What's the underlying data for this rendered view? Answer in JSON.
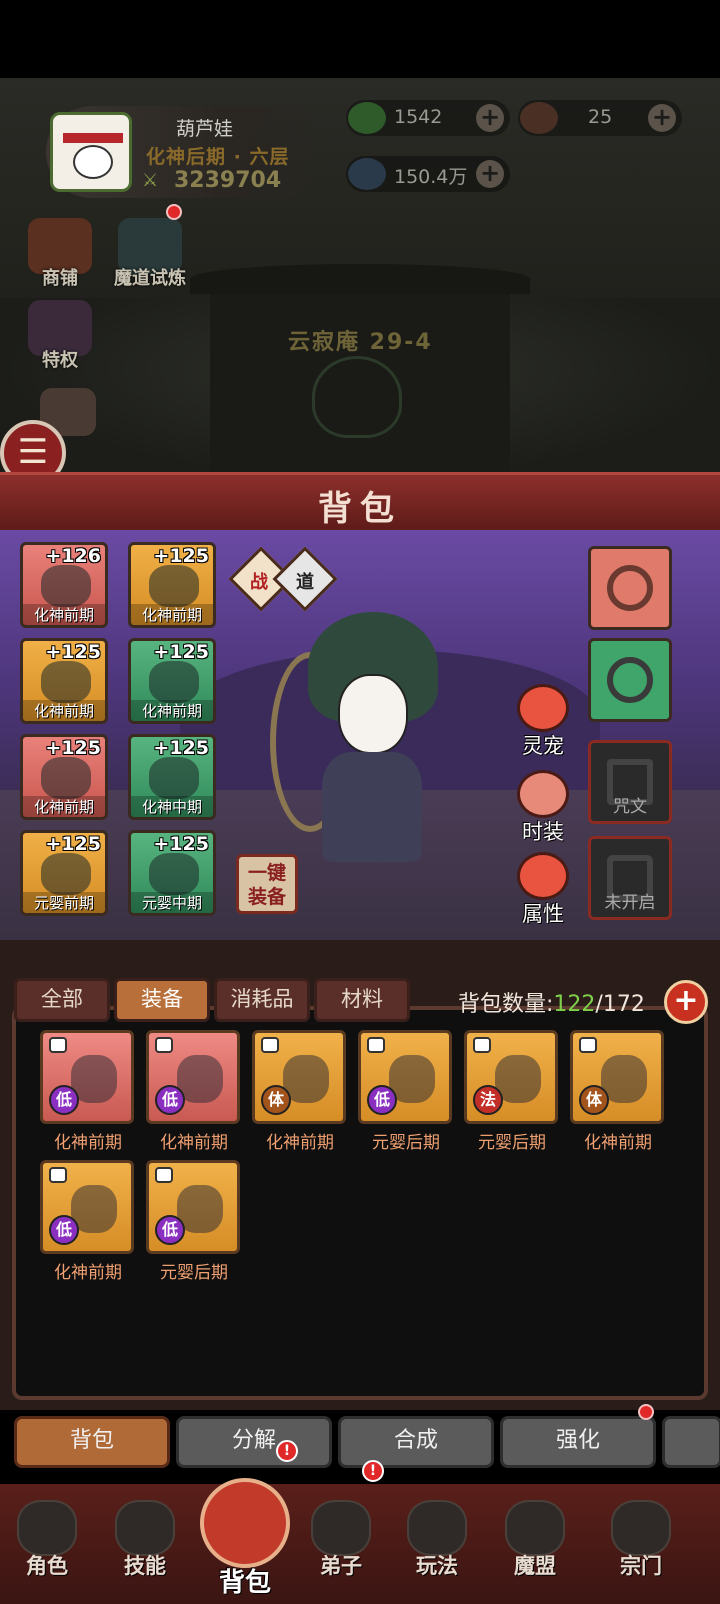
{
  "player": {
    "name": "葫芦娃",
    "rank": "化神后期 · 六层",
    "power": "3239704"
  },
  "currencies": [
    {
      "icon": "jade-coin-icon",
      "value": "1542"
    },
    {
      "icon": "beast-token-icon",
      "value": "25"
    },
    {
      "icon": "spirit-crystal-icon",
      "value": "150.4万"
    }
  ],
  "side_buttons": {
    "shop": "商铺",
    "trial": "魔道试炼",
    "privilege": "特权"
  },
  "stage": "云寂庵 29-4",
  "header": {
    "title": "背包"
  },
  "mode_toggle": {
    "left": "战",
    "right": "道"
  },
  "equipped_slots": [
    {
      "level": "+126",
      "rank": "化神前期",
      "color": "red",
      "icon": "bow-icon"
    },
    {
      "level": "+125",
      "rank": "化神前期",
      "color": "orange",
      "icon": "talisman-icon"
    },
    {
      "level": "+125",
      "rank": "化神前期",
      "color": "orange",
      "icon": "cape-icon"
    },
    {
      "level": "+125",
      "rank": "化神前期",
      "color": "green",
      "icon": "robe-icon"
    },
    {
      "level": "+125",
      "rank": "化神前期",
      "color": "red",
      "icon": "amulet-icon"
    },
    {
      "level": "+125",
      "rank": "化神中期",
      "color": "green",
      "icon": "whip-icon"
    },
    {
      "level": "+125",
      "rank": "元婴前期",
      "color": "orange",
      "icon": "ring-icon"
    },
    {
      "level": "+125",
      "rank": "元婴中期",
      "color": "green",
      "icon": "ring-icon"
    }
  ],
  "right_slots": {
    "curse": "咒文",
    "locked": "未开启"
  },
  "func_buttons": {
    "pet": "灵宠",
    "fashion": "时装",
    "attributes": "属性"
  },
  "one_key": "一键装备",
  "categories": [
    "全部",
    "装备",
    "消耗品",
    "材料"
  ],
  "capacity": {
    "label": "背包数量:",
    "used": "122",
    "total": "/172"
  },
  "items": [
    {
      "rank": "化神前期",
      "color": "red",
      "tag": "低",
      "tag_color": "purple"
    },
    {
      "rank": "化神前期",
      "color": "red",
      "tag": "低",
      "tag_color": "purple"
    },
    {
      "rank": "化神前期",
      "color": "orange",
      "tag": "体",
      "tag_color": "brown"
    },
    {
      "rank": "元婴后期",
      "color": "orange",
      "tag": "低",
      "tag_color": "purple"
    },
    {
      "rank": "元婴后期",
      "color": "orange",
      "tag": "法",
      "tag_color": "red"
    },
    {
      "rank": "化神前期",
      "color": "orange",
      "tag": "体",
      "tag_color": "brown"
    },
    {
      "rank": "化神前期",
      "color": "orange",
      "tag": "低",
      "tag_color": "purple"
    },
    {
      "rank": "元婴后期",
      "color": "orange",
      "tag": "低",
      "tag_color": "purple"
    }
  ],
  "actions": [
    "背包",
    "分解",
    "合成",
    "强化"
  ],
  "nav": [
    "角色",
    "技能",
    "背包",
    "弟子",
    "玩法",
    "魔盟",
    "宗门"
  ],
  "badges": {
    "alert": "!"
  }
}
